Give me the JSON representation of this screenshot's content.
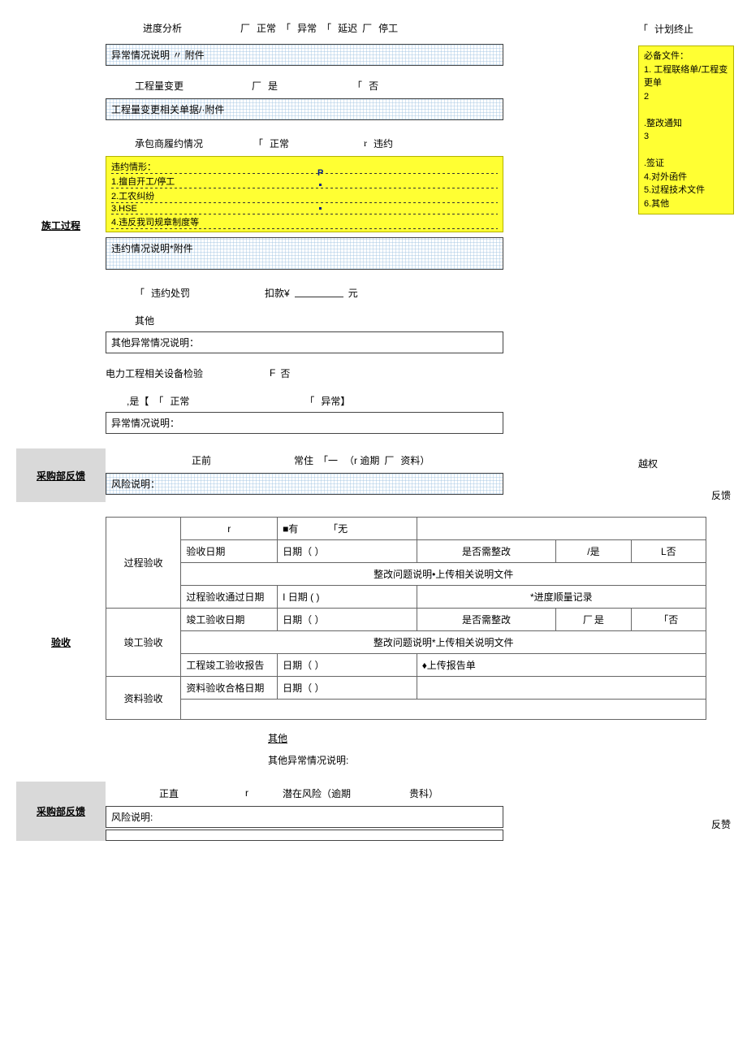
{
  "construction": {
    "section_label": "族工过程",
    "progress_label": "进度分析",
    "progress_opts": {
      "normal": "正常",
      "abnormal": "异常",
      "delay": "延迟",
      "stop": "停工"
    },
    "plan_terminate": "计划终止",
    "abnormal_desc": "异常情况说明 〃 附件",
    "qty_change_label": "工程量变更",
    "yes": "是",
    "no": "否",
    "qty_change_docs": "工程量变更相关单据/·附件",
    "contractor_label": "承包商履约情况",
    "contractor_normal": "正常",
    "contractor_breach": "违约",
    "breach_head": "违约情形：",
    "breach1": "1.擅自开工/停工",
    "breach2": "2.工农纠纷",
    "breach3": "3.HSE",
    "breach4": "4.违反我司规章制度等",
    "breach_desc": "违约情况说明*附件",
    "breach_penalty_label": "违约处罚",
    "deduct_pre": "扣款¥",
    "deduct_suf": "元",
    "other_label": "其他",
    "other_desc": "其他异常情况说明：",
    "power_check": "电力工程相关设备检验",
    "f_no": "否",
    "is_normal_pre": ",是【",
    "is_normal": "正常",
    "is_abnormal": "异常】",
    "abn_desc2": "异常情况说明：",
    "docs_head": "必备文件：",
    "docs1": "1. 工程联络单/工程变更单",
    "docs2a": "2",
    "docs2b": ".整改通知",
    "docs3a": "3",
    "docs3b": ".签证",
    "docs4": "4.对外函件",
    "docs5": "5.过程技术文件",
    "docs6": "6.其他"
  },
  "procurement1": {
    "section_label": "采购部反馈",
    "front": "正前",
    "resident": "常住",
    "bracket_l": "「一",
    "overdue": "（r 逾期",
    "docs": "资料）",
    "permit": "越权",
    "risk_desc": "风险说明：",
    "feedback": "反馈"
  },
  "acceptance": {
    "section_label": "验收",
    "process": "过程验收",
    "r_mark": "r",
    "has": "■有",
    "none": "「无",
    "accept_date": "验收日期",
    "date_paren": "日期（    ）",
    "need_fix": "是否需整改",
    "fix_yes": "/是",
    "fix_no": "L否",
    "fix_desc": "整改问题说明•上传相关说明文件",
    "pass_date": "过程验收通过日期",
    "i_date": "I 日期 (  )",
    "progress_rec": "*进度顺量记录",
    "complete": "竣工验收",
    "complete_date": "竣工验收日期",
    "date_paren2": "日期（    ）",
    "need_fix2": "是否需整改",
    "fix_yes2": "是",
    "fix_no2": "「否",
    "fix_desc2": "整改问题说明*上传相关说明文件",
    "complete_report": "工程竣工验收报告",
    "date_paren3": "日期（    ）",
    "upload_report": "♦上传报告单",
    "material": "资料验收",
    "material_date": "资料验收合格日期",
    "date_paren4": "日期（    ）",
    "other_under": "其他",
    "other_abn": "其他异常情况说明:"
  },
  "procurement2": {
    "section_label": "采购部反馈",
    "honest": "正直",
    "r": "r",
    "risk": "潜在风险（逾期",
    "subject": "贵科）",
    "risk_desc": "风险说明:",
    "feedback": "反赞"
  }
}
